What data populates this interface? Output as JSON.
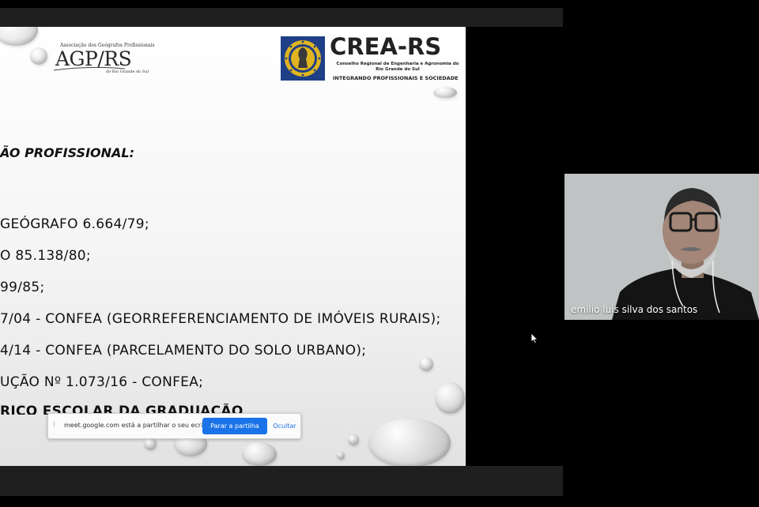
{
  "presentation": {
    "agp_logo": {
      "small_text": "Associação dos Geógrafos Profissionais",
      "name": "AGP/RS",
      "region": "do Rio Grande do Sul"
    },
    "crea_logo": {
      "name": "CREA-RS",
      "subtitle": "Conselho Regional de Engenharia e Agronomia do Rio Grande do Sul",
      "tagline": "INTEGRANDO PROFISSIONAIS E SOCIEDADE"
    },
    "heading": "ÃO PROFISSIONAL:",
    "lines": [
      "GEÓGRAFO 6.664/79;",
      "O 85.138/80;",
      "99/85;",
      "7/04 - CONFEA (GEORREFERENCIAMENTO DE IMÓVEIS RURAIS);",
      "4/14 - CONFEA (PARCELAMENTO DO SOLO URBANO);",
      "UÇÃO Nº 1.073/16 - CONFEA;",
      "RICO ESCOLAR DA GRADUAÇÃO"
    ]
  },
  "share_notice": {
    "text": "meet.google.com está a partilhar o seu ecrã.",
    "stop_label": "Parar a partilha",
    "hide_label": "Ocultar"
  },
  "participant": {
    "name": "emilio luis silva dos santos"
  },
  "colors": {
    "background": "#000000",
    "accent": "#1a73e8",
    "crea_blue": "#1f3f86",
    "crea_gold": "#e0b520"
  }
}
